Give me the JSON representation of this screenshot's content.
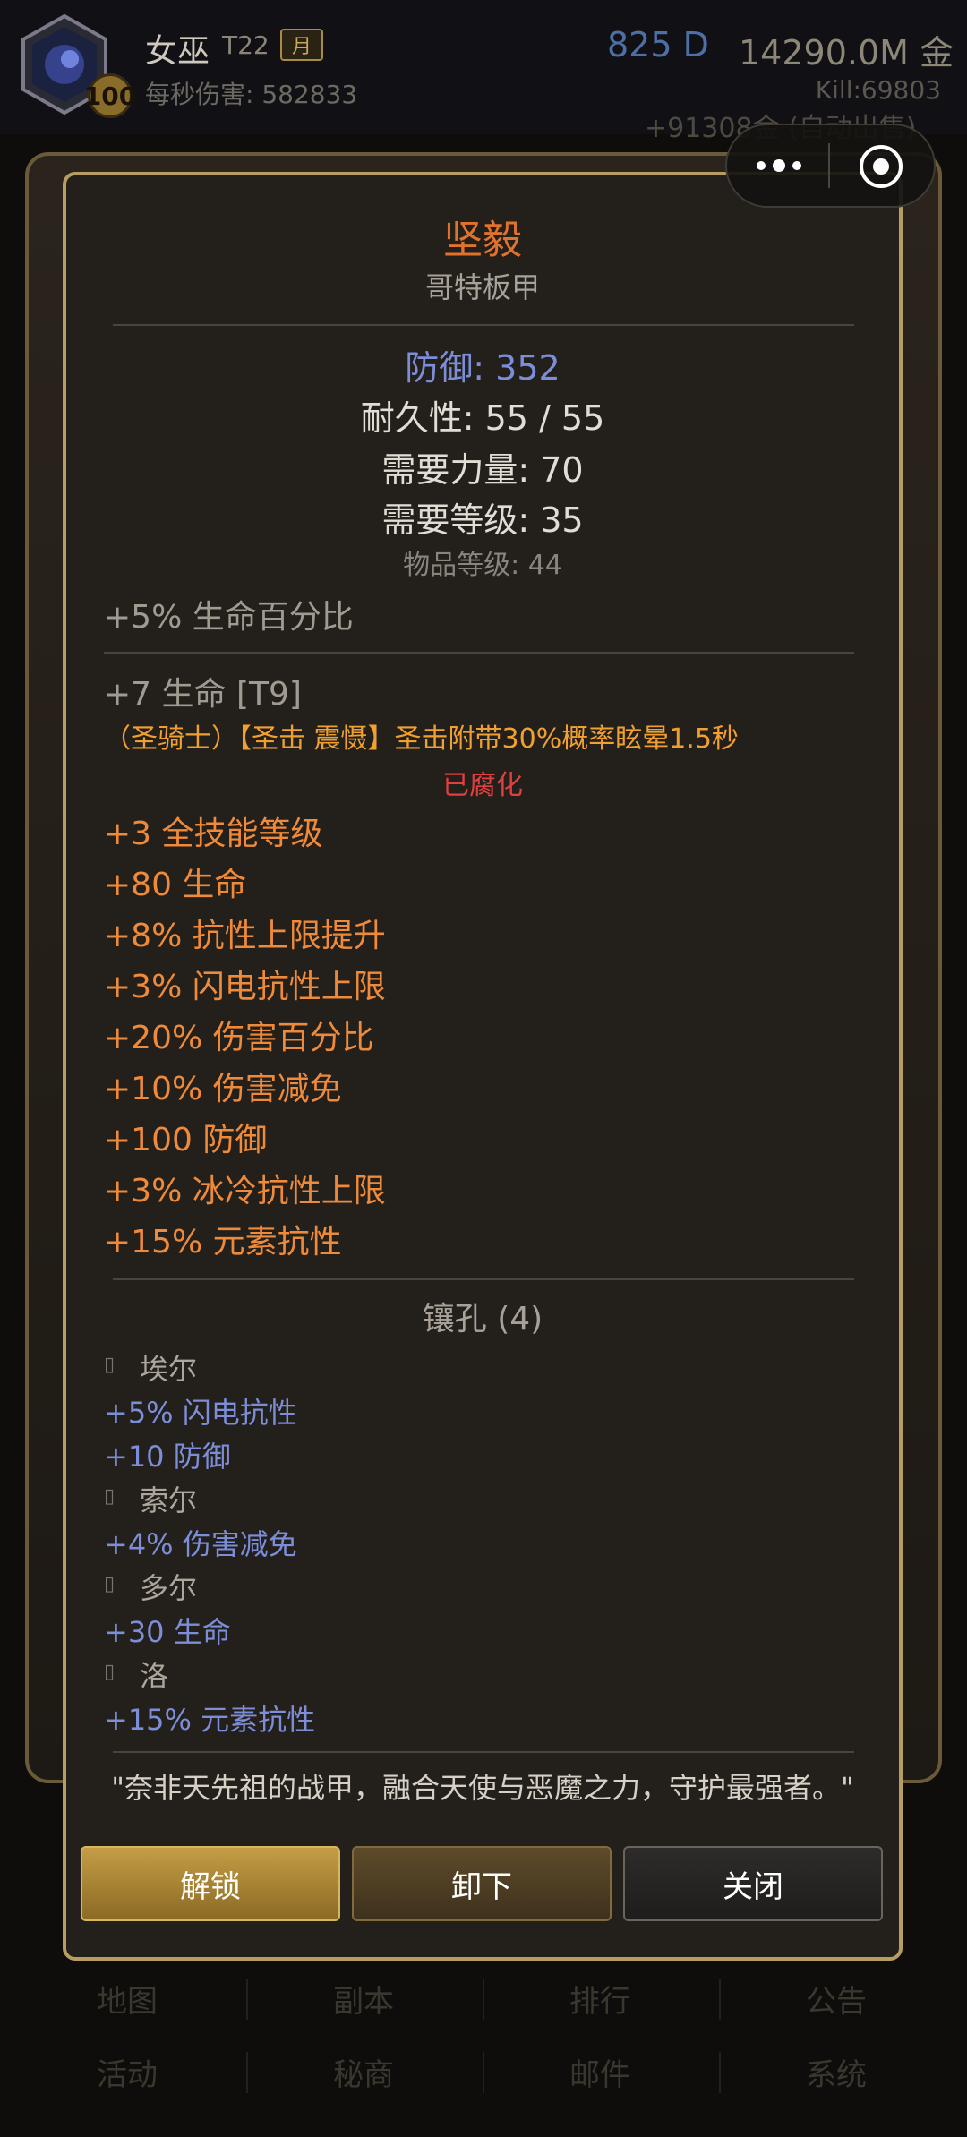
{
  "header": {
    "level": "100",
    "char_name": "女巫",
    "tier": "T22",
    "month_badge": "月",
    "dps_label": "每秒伤害: 582833",
    "diamonds": "825 D",
    "gold": "14290.0M 金",
    "kills": "Kill:69803",
    "auto_gold": "+91308金 (自动出售)"
  },
  "item": {
    "name": "坚毅",
    "base_type": "哥特板甲",
    "defense": "防御: 352",
    "durability": "耐久性: 55 / 55",
    "req_str": "需要力量: 70",
    "req_level": "需要等级: 35",
    "item_level": "物品等级: 44",
    "implicit": "+5% 生命百分比",
    "enchant": "+7 生命 [T9]",
    "legendary": "（圣骑士）【圣击 震慑】圣击附带30%概率眩晕1.5秒",
    "corrupted": "已腐化",
    "affixes": [
      "+3 全技能等级",
      "+80 生命",
      "+8% 抗性上限提升",
      "+3% 闪电抗性上限",
      "+20% 伤害百分比",
      "+10% 伤害减免",
      "+100 防御",
      "+3% 冰冷抗性上限",
      "+15% 元素抗性"
    ],
    "sockets_header": "镶孔 (4)",
    "gems": [
      {
        "name": "埃尔",
        "mods": [
          "+5% 闪电抗性",
          "+10 防御"
        ]
      },
      {
        "name": "索尔",
        "mods": [
          "+4% 伤害减免"
        ]
      },
      {
        "name": "多尔",
        "mods": [
          "+30 生命"
        ]
      },
      {
        "name": "洛",
        "mods": [
          "+15% 元素抗性"
        ]
      }
    ],
    "flavor": "\"奈非天先祖的战甲，融合天使与恶魔之力，守护最强者。\""
  },
  "buttons": {
    "unlock": "解锁",
    "unequip": "卸下",
    "close": "关闭"
  },
  "nav": {
    "row1": [
      "地图",
      "副本",
      "排行",
      "公告"
    ],
    "row2": [
      "活动",
      "秘商",
      "邮件",
      "系统"
    ]
  },
  "colors": {
    "legendary_orange": "#ee8a3a",
    "magic_blue": "#7d8ed8",
    "corrupted_red": "#e04040",
    "gold_frame": "#b89d62"
  }
}
